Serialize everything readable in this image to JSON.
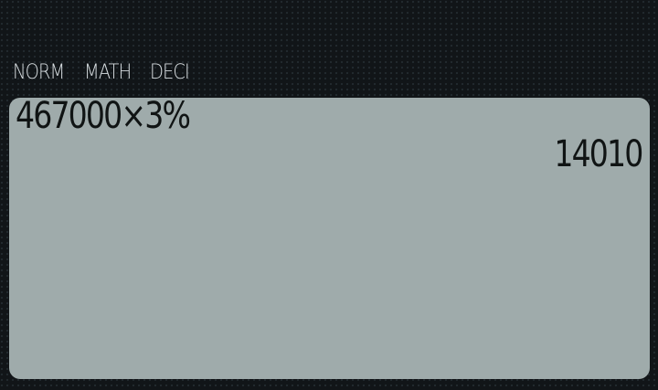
{
  "status": {
    "items": [
      "NORM",
      "MATH",
      "DECI"
    ]
  },
  "display": {
    "expression": "467000×3%",
    "result": "14010"
  }
}
